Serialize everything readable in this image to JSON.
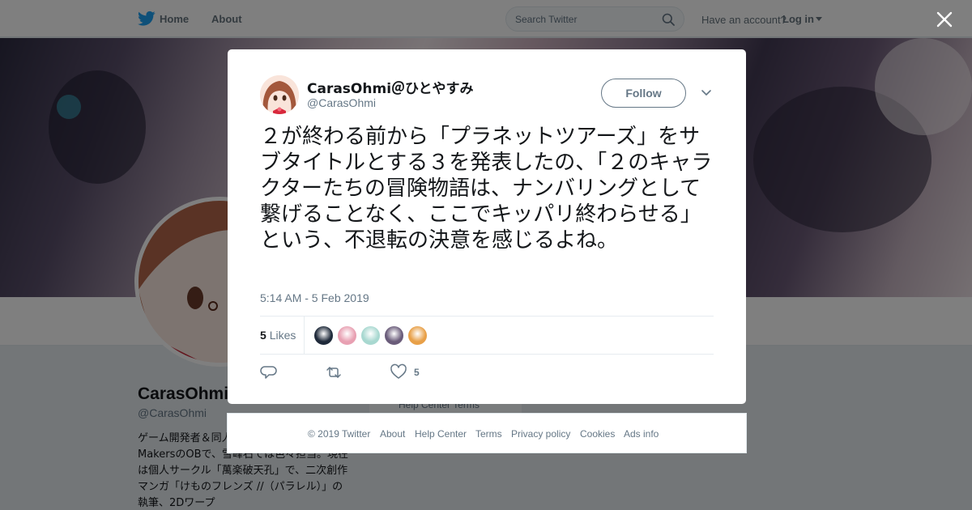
{
  "nav": {
    "home_label": "Home",
    "about_label": "About",
    "search_placeholder": "Search Twitter",
    "account_prompt": "Have an account?",
    "login_label": "Log in"
  },
  "profile": {
    "name": "CarasOhmi",
    "handle": "@CarasOhmi",
    "bio": "ゲーム開発者＆同人作家。Amusement MakersのOBで、雪峰石では色々担当。現在は個人サークル「萬楽破天孔」で、二次創作マンガ「けものフレンズ //（パラレル）」の執筆、2Dワープ",
    "behind_links": "Help Center   Terms"
  },
  "tweet": {
    "display_name": "CarasOhmi＠ひとやすみ",
    "handle": "@CarasOhmi",
    "follow_label": "Follow",
    "text": "２が終わる前から「プラネットツアーズ」をサブタイトルとする３を発表したの、「２のキャラクターたちの冒険物語は、ナンバリングとして繋げることなく、ここでキッパリ終わらせる」という、不退転の決意を感じるよね。",
    "timestamp": "5:14 AM - 5 Feb 2019",
    "likes_count": "5",
    "likes_label": "Likes",
    "like_action_count": "5",
    "liker_avatar_colors": [
      "#1f2a3a",
      "#e8a0b2",
      "#a8d8d0",
      "#6a5c7a",
      "#e8a048"
    ]
  },
  "footer": {
    "copyright": "© 2019 Twitter",
    "about": "About",
    "help_center": "Help Center",
    "terms": "Terms",
    "privacy": "Privacy policy",
    "cookies": "Cookies",
    "ads_info": "Ads info"
  },
  "colors": {
    "twitter_blue": "#1da1f2",
    "muted_text": "#657786",
    "overlay": "rgba(0,0,0,0.5)"
  },
  "icons": [
    "twitter-bird-icon",
    "search-icon",
    "caret-down-icon",
    "close-icon",
    "reply-icon",
    "retweet-icon",
    "heart-icon"
  ]
}
